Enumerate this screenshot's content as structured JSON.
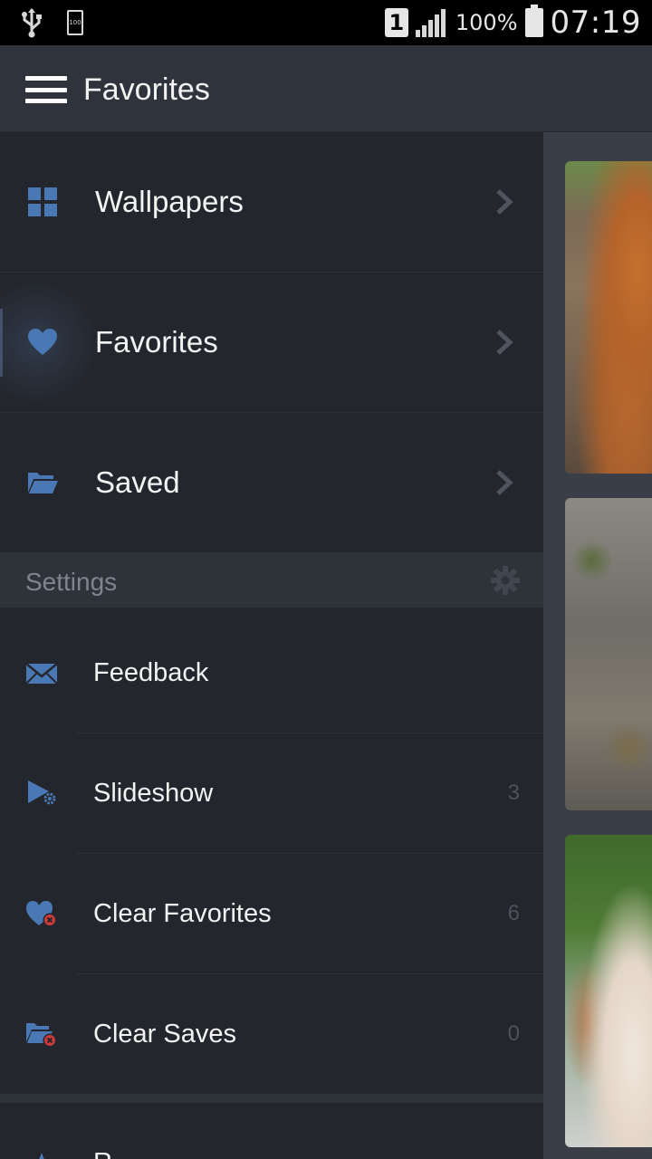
{
  "status_bar": {
    "battery_small_text": "100",
    "sim_slot": "1",
    "battery_percent": "100%",
    "time": "07:19"
  },
  "action_bar": {
    "title": "Favorites",
    "menu_icon": "hamburger-menu-icon"
  },
  "drawer": {
    "nav_items": [
      {
        "label": "Wallpapers",
        "icon": "grid-icon"
      },
      {
        "label": "Favorites",
        "icon": "heart-icon",
        "active": true
      },
      {
        "label": "Saved",
        "icon": "folder-open-icon"
      }
    ],
    "settings_header": "Settings",
    "settings_items": [
      {
        "label": "Feedback",
        "icon": "envelope-icon",
        "count": ""
      },
      {
        "label": "Slideshow",
        "icon": "play-gear-icon",
        "count": "3"
      },
      {
        "label": "Clear Favorites",
        "icon": "heart-remove-icon",
        "count": "6"
      },
      {
        "label": "Clear Saves",
        "icon": "folder-remove-icon",
        "count": "0"
      }
    ],
    "partial_item": {
      "label": "R",
      "icon": "star-icon"
    }
  },
  "colors": {
    "accent": "#4a78b5",
    "drawer_bg": "#23262c",
    "action_bar_bg": "#2f333c",
    "section_header_bg": "#2e3239",
    "remove_red": "#d03a3a"
  }
}
